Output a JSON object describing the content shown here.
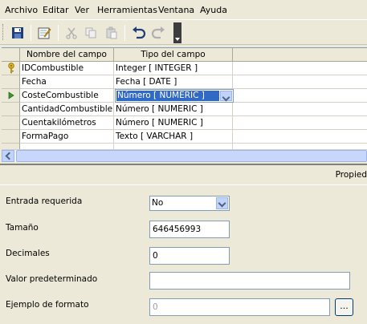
{
  "menu": [
    "Archivo",
    "Editar",
    "Ver",
    "Herramientas",
    "Ventana",
    "Ayuda"
  ],
  "toolbar": {
    "icons": [
      "save-icon",
      "edit-icon",
      "cut-icon",
      "copy-icon",
      "paste-icon",
      "undo-icon",
      "redo-icon",
      "more-options-icon"
    ]
  },
  "grid": {
    "columns": [
      "Nombre del campo",
      "Tipo del campo"
    ],
    "rows": [
      {
        "name": "IDCombustible",
        "type": "Integer [ INTEGER ]",
        "marker": "key"
      },
      {
        "name": "Fecha",
        "type": "Fecha [ DATE ]",
        "marker": ""
      },
      {
        "name": "CosteCombustible",
        "type": "Número [ NUMERIC ]",
        "marker": "current"
      },
      {
        "name": "CantidadCombustible",
        "type": "Número [ NUMERIC ]",
        "marker": ""
      },
      {
        "name": "Cuentakilómetros",
        "type": "Número [ NUMERIC ]",
        "marker": ""
      },
      {
        "name": "FormaPago",
        "type": "Texto [ VARCHAR ]",
        "marker": ""
      }
    ]
  },
  "properties": {
    "title": "Propied",
    "required": {
      "label": "Entrada requerida",
      "value": "No"
    },
    "size": {
      "label": "Tamaño",
      "value": "646456993"
    },
    "decimals": {
      "label": "Decimales",
      "value": "0"
    },
    "default": {
      "label": "Valor predeterminado",
      "value": ""
    },
    "format_example": {
      "label": "Ejemplo de formato",
      "value": "0",
      "button": "..."
    }
  },
  "colors": {
    "selection": "#316ac5",
    "key_icon": "#d4a017",
    "current_row_arrow": "#3a9a2a"
  }
}
